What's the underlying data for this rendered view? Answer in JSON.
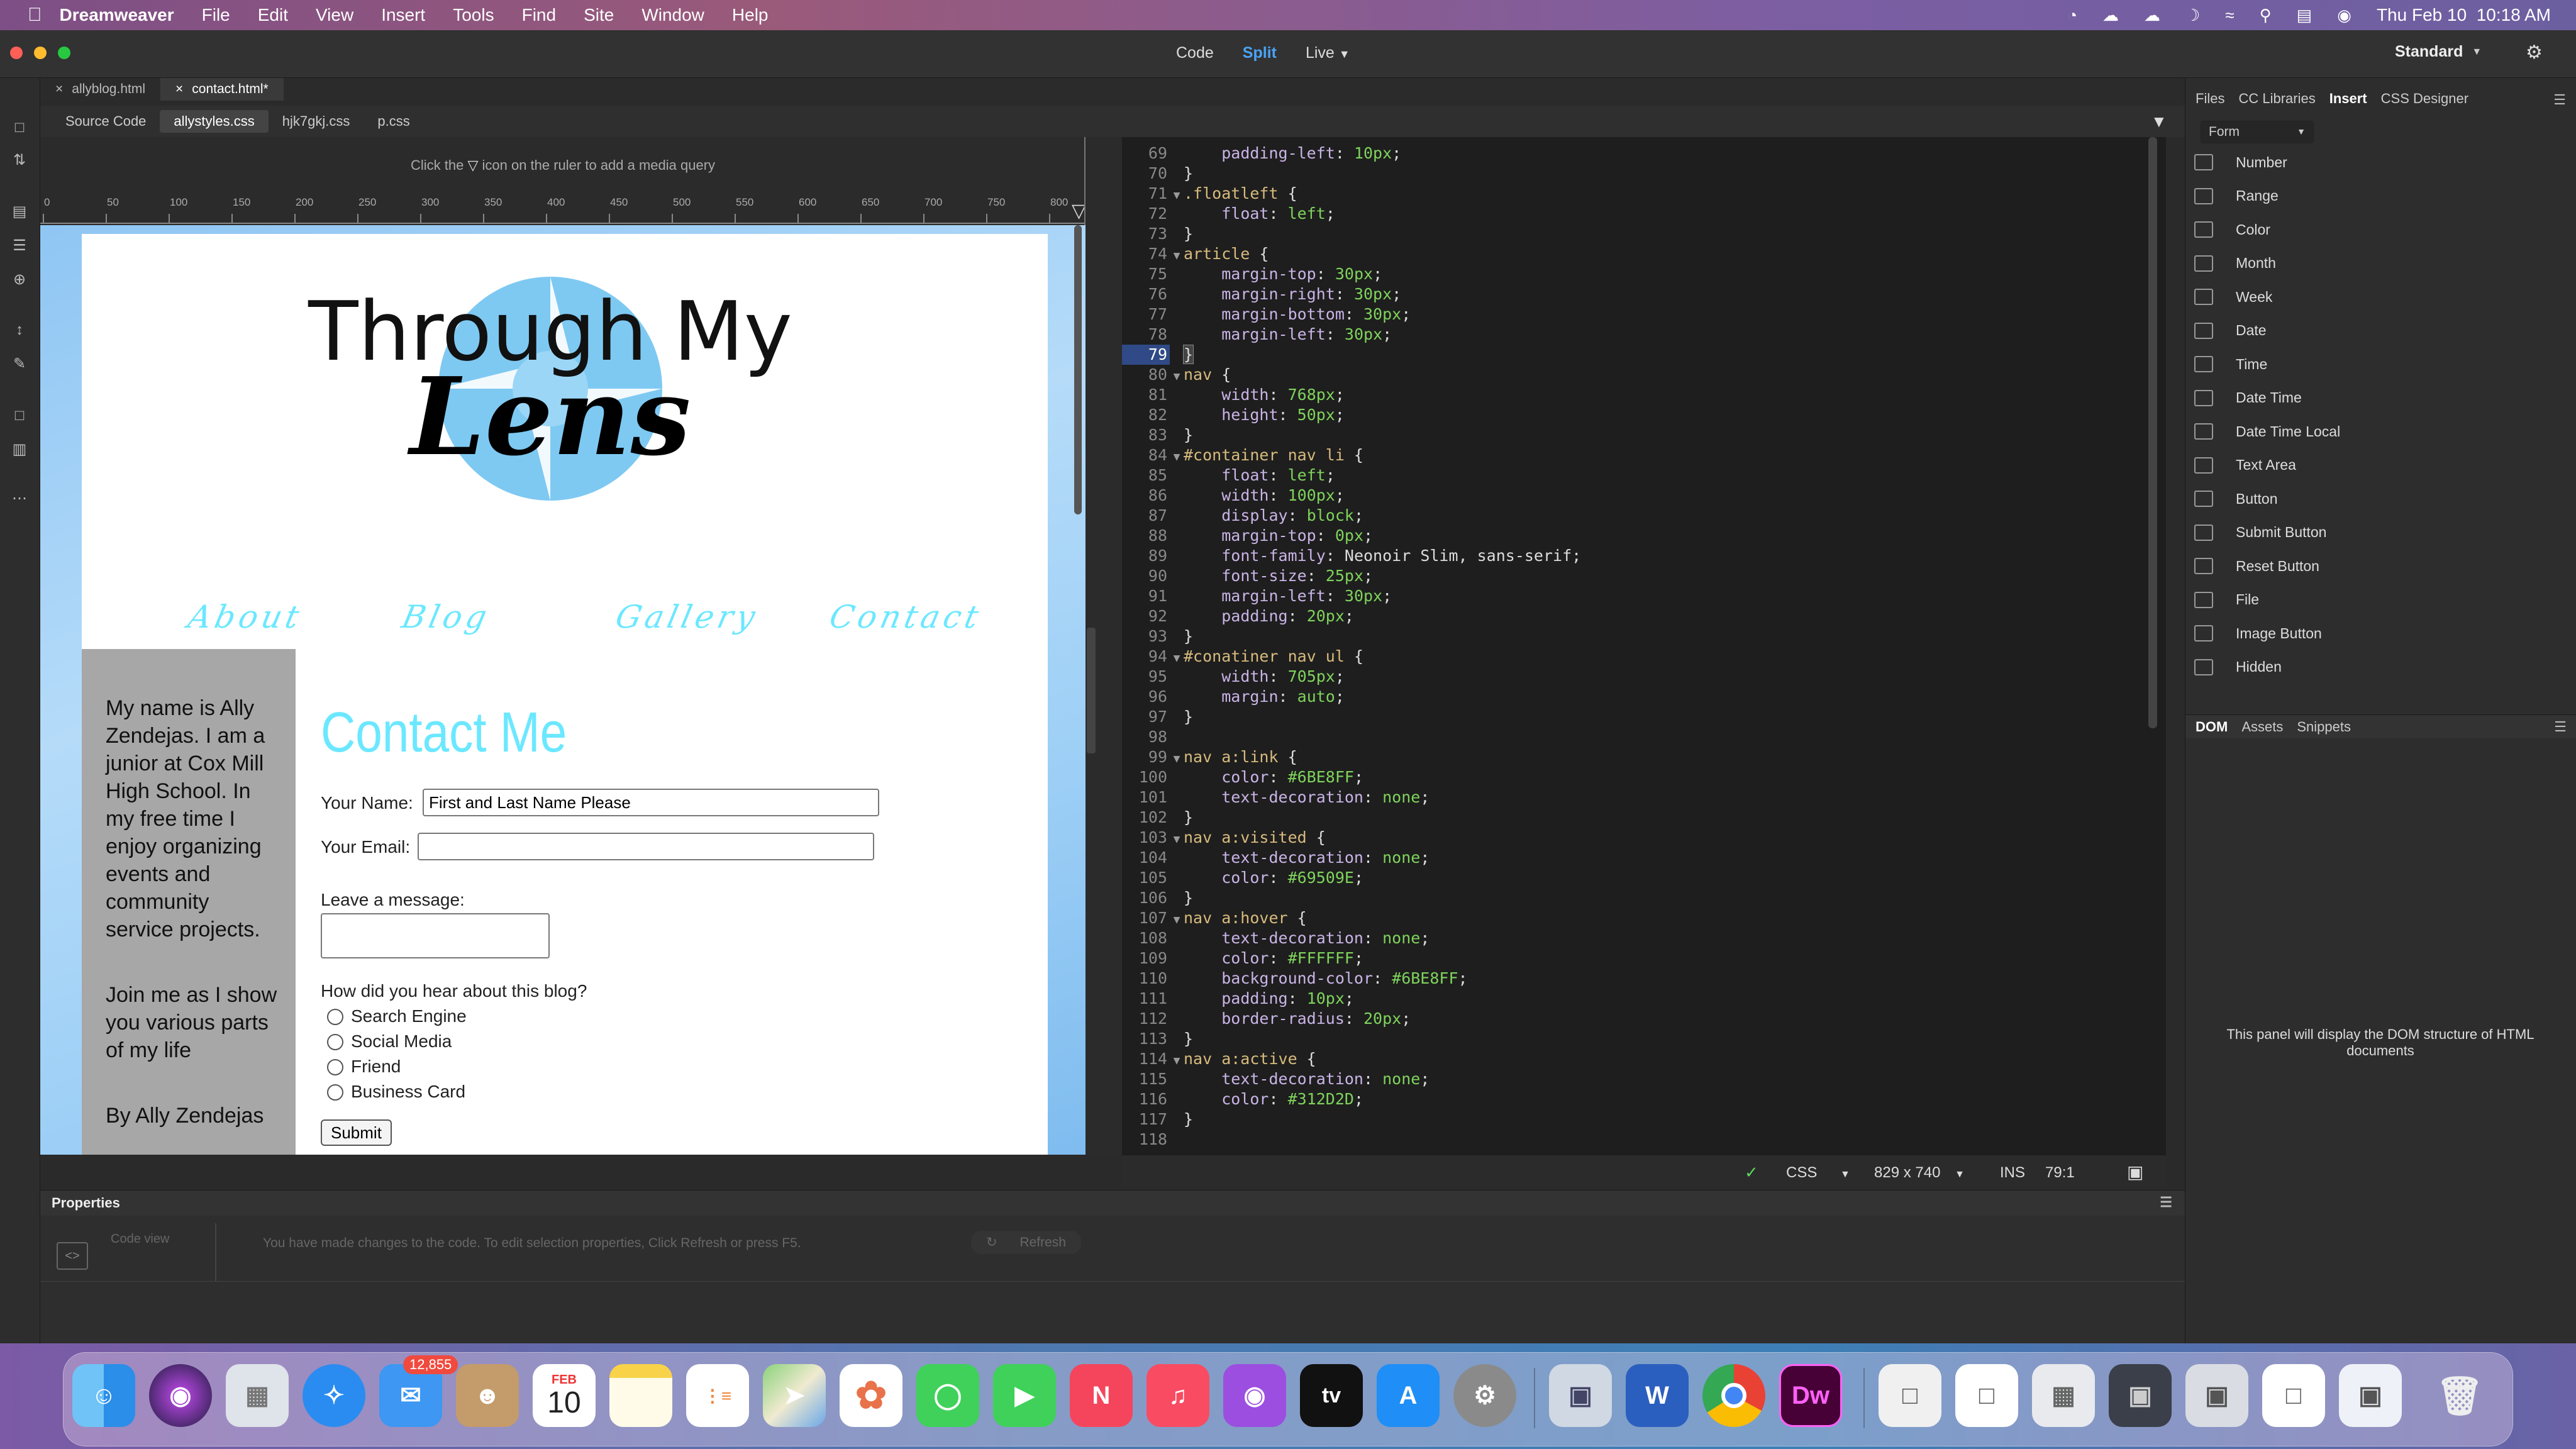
{
  "menubar": {
    "app_name": "Dreamweaver",
    "items": [
      "File",
      "Edit",
      "View",
      "Insert",
      "Tools",
      "Find",
      "Site",
      "Window",
      "Help"
    ],
    "clock": "Thu Feb 10  10:18 AM"
  },
  "titlebar": {
    "views": [
      "Code",
      "Split",
      "Live"
    ],
    "active_view": "Split",
    "workspace": "Standard"
  },
  "doc_tabs": [
    {
      "label": "allyblog.html",
      "active": false
    },
    {
      "label": "contact.html*",
      "active": true
    }
  ],
  "related_files": [
    {
      "label": "Source Code",
      "active": false
    },
    {
      "label": "allystyles.css",
      "active": true
    },
    {
      "label": "hjk7gkj.css",
      "active": false
    },
    {
      "label": "p.css",
      "active": false
    }
  ],
  "media_query_hint": {
    "before": "Click the",
    "after": "icon on the ruler to add a media query"
  },
  "ruler_ticks": [
    "0",
    "50",
    "100",
    "150",
    "200",
    "250",
    "300",
    "350",
    "400",
    "450",
    "500",
    "550",
    "600",
    "650",
    "700",
    "750",
    "800"
  ],
  "live_page": {
    "logo_line1": "Through My",
    "logo_line2": "Lens",
    "nav": [
      "About",
      "Blog",
      "Gallery",
      "Contact"
    ],
    "sidebar": {
      "para1": "My name is Ally Zendejas. I am a junior at Cox Mill High School. In my free time I enjoy organizing events and community service projects.",
      "para2": "Join me as I show you various parts of my life",
      "byline": "By Ally Zendejas"
    },
    "form": {
      "title": "Contact Me",
      "name_label": "Your Name:",
      "name_value": "First and Last Name Please",
      "email_label": "Your Email:",
      "message_label": "Leave a message:",
      "question": "How did you hear about this blog?",
      "options": [
        "Search Engine",
        "Social Media",
        "Friend",
        "Business Card"
      ],
      "submit": "Submit"
    }
  },
  "code_lines": [
    {
      "n": "69",
      "fold": "",
      "text": "    padding-left: 10px;",
      "kind": "decl",
      "prop": "padding-left",
      "value": "10px"
    },
    {
      "n": "70",
      "fold": "",
      "text": "}",
      "kind": "brace"
    },
    {
      "n": "71",
      "fold": "▼",
      "text": ".floatleft {",
      "kind": "sel",
      "sel": ".floatleft"
    },
    {
      "n": "72",
      "fold": "",
      "text": "    float: left;",
      "kind": "decl",
      "prop": "float",
      "value": "left"
    },
    {
      "n": "73",
      "fold": "",
      "text": "}",
      "kind": "brace"
    },
    {
      "n": "74",
      "fold": "▼",
      "text": "article {",
      "kind": "sel",
      "sel": "article"
    },
    {
      "n": "75",
      "fold": "",
      "text": "    margin-top: 30px;",
      "kind": "decl",
      "prop": "margin-top",
      "value": "30px"
    },
    {
      "n": "76",
      "fold": "",
      "text": "    margin-right: 30px;",
      "kind": "decl",
      "prop": "margin-right",
      "value": "30px"
    },
    {
      "n": "77",
      "fold": "",
      "text": "    margin-bottom: 30px;",
      "kind": "decl",
      "prop": "margin-bottom",
      "value": "30px"
    },
    {
      "n": "78",
      "fold": "",
      "text": "    margin-left: 30px;",
      "kind": "decl",
      "prop": "margin-left",
      "value": "30px"
    },
    {
      "n": "79",
      "fold": "",
      "text": "}",
      "kind": "brace",
      "current": true
    },
    {
      "n": "80",
      "fold": "▼",
      "text": "nav {",
      "kind": "sel",
      "sel": "nav"
    },
    {
      "n": "81",
      "fold": "",
      "text": "    width: 768px;",
      "kind": "decl",
      "prop": "width",
      "value": "768px"
    },
    {
      "n": "82",
      "fold": "",
      "text": "    height: 50px;",
      "kind": "decl",
      "prop": "height",
      "value": "50px"
    },
    {
      "n": "83",
      "fold": "",
      "text": "}",
      "kind": "brace"
    },
    {
      "n": "84",
      "fold": "▼",
      "text": "#container nav li {",
      "kind": "sel",
      "sel": "#container nav li"
    },
    {
      "n": "85",
      "fold": "",
      "text": "    float: left;",
      "kind": "decl",
      "prop": "float",
      "value": "left"
    },
    {
      "n": "86",
      "fold": "",
      "text": "    width: 100px;",
      "kind": "decl",
      "prop": "width",
      "value": "100px"
    },
    {
      "n": "87",
      "fold": "",
      "text": "    display: block;",
      "kind": "decl",
      "prop": "display",
      "value": "block"
    },
    {
      "n": "88",
      "fold": "",
      "text": "    margin-top: 0px;",
      "kind": "decl",
      "prop": "margin-top",
      "value": "0px"
    },
    {
      "n": "89",
      "fold": "",
      "text": "    font-family: Neonoir Slim, sans-serif;",
      "kind": "decl",
      "prop": "font-family",
      "value": "Neonoir Slim, sans-serif"
    },
    {
      "n": "90",
      "fold": "",
      "text": "    font-size: 25px;",
      "kind": "decl",
      "prop": "font-size",
      "value": "25px"
    },
    {
      "n": "91",
      "fold": "",
      "text": "    margin-left: 30px;",
      "kind": "decl",
      "prop": "margin-left",
      "value": "30px"
    },
    {
      "n": "92",
      "fold": "",
      "text": "    padding: 20px;",
      "kind": "decl",
      "prop": "padding",
      "value": "20px"
    },
    {
      "n": "93",
      "fold": "",
      "text": "}",
      "kind": "brace"
    },
    {
      "n": "94",
      "fold": "▼",
      "text": "#conatiner nav ul {",
      "kind": "sel",
      "sel": "#conatiner nav ul"
    },
    {
      "n": "95",
      "fold": "",
      "text": "    width: 705px;",
      "kind": "decl",
      "prop": "width",
      "value": "705px"
    },
    {
      "n": "96",
      "fold": "",
      "text": "    margin: auto;",
      "kind": "decl",
      "prop": "margin",
      "value": "auto"
    },
    {
      "n": "97",
      "fold": "",
      "text": "}",
      "kind": "brace"
    },
    {
      "n": "98",
      "fold": "",
      "text": "",
      "kind": "blank"
    },
    {
      "n": "99",
      "fold": "▼",
      "text": "nav a:link {",
      "kind": "sel",
      "sel": "nav a:link"
    },
    {
      "n": "100",
      "fold": "",
      "text": "    color: #6BE8FF;",
      "kind": "decl",
      "prop": "color",
      "value": "#6BE8FF"
    },
    {
      "n": "101",
      "fold": "",
      "text": "    text-decoration: none;",
      "kind": "decl",
      "prop": "text-decoration",
      "value": "none"
    },
    {
      "n": "102",
      "fold": "",
      "text": "}",
      "kind": "brace"
    },
    {
      "n": "103",
      "fold": "▼",
      "text": "nav a:visited {",
      "kind": "sel",
      "sel": "nav a:visited"
    },
    {
      "n": "104",
      "fold": "",
      "text": "    text-decoration: none;",
      "kind": "decl",
      "prop": "text-decoration",
      "value": "none"
    },
    {
      "n": "105",
      "fold": "",
      "text": "    color: #69509E;",
      "kind": "decl",
      "prop": "color",
      "value": "#69509E"
    },
    {
      "n": "106",
      "fold": "",
      "text": "}",
      "kind": "brace"
    },
    {
      "n": "107",
      "fold": "▼",
      "text": "nav a:hover {",
      "kind": "sel",
      "sel": "nav a:hover"
    },
    {
      "n": "108",
      "fold": "",
      "text": "    text-decoration: none;",
      "kind": "decl",
      "prop": "text-decoration",
      "value": "none"
    },
    {
      "n": "109",
      "fold": "",
      "text": "    color: #FFFFFF;",
      "kind": "decl",
      "prop": "color",
      "value": "#FFFFFF"
    },
    {
      "n": "110",
      "fold": "",
      "text": "    background-color: #6BE8FF;",
      "kind": "decl",
      "prop": "background-color",
      "value": "#6BE8FF"
    },
    {
      "n": "111",
      "fold": "",
      "text": "    padding: 10px;",
      "kind": "decl",
      "prop": "padding",
      "value": "10px"
    },
    {
      "n": "112",
      "fold": "",
      "text": "    border-radius: 20px;",
      "kind": "decl",
      "prop": "border-radius",
      "value": "20px"
    },
    {
      "n": "113",
      "fold": "",
      "text": "}",
      "kind": "brace"
    },
    {
      "n": "114",
      "fold": "▼",
      "text": "nav a:active {",
      "kind": "sel",
      "sel": "nav a:active"
    },
    {
      "n": "115",
      "fold": "",
      "text": "    text-decoration: none;",
      "kind": "decl",
      "prop": "text-decoration",
      "value": "none"
    },
    {
      "n": "116",
      "fold": "",
      "text": "    color: #312D2D;",
      "kind": "decl",
      "prop": "color",
      "value": "#312D2D"
    },
    {
      "n": "117",
      "fold": "",
      "text": "}",
      "kind": "brace"
    },
    {
      "n": "118",
      "fold": "",
      "text": "",
      "kind": "blank"
    }
  ],
  "code_status": {
    "language": "CSS",
    "size": "829 x 740",
    "mode": "INS",
    "position": "79:1"
  },
  "properties": {
    "title": "Properties",
    "code_view": "Code view",
    "message": "You have made changes to the code. To edit selection properties, Click Refresh or press F5.",
    "refresh": "Refresh"
  },
  "right_panel": {
    "tabs": [
      "Files",
      "CC Libraries",
      "Insert",
      "CSS Designer"
    ],
    "active_tab": "Insert",
    "category": "Form",
    "insert_items": [
      "Number",
      "Range",
      "Color",
      "Month",
      "Week",
      "Date",
      "Time",
      "Date Time",
      "Date Time Local",
      "Text Area",
      "Button",
      "Submit Button",
      "Reset Button",
      "File",
      "Image Button",
      "Hidden"
    ],
    "lower_tabs": [
      "DOM",
      "Assets",
      "Snippets"
    ],
    "dom_message": "This panel will display the DOM structure of HTML documents"
  },
  "dock": {
    "mail_badge": "12,855",
    "calendar_month": "FEB",
    "calendar_day": "10",
    "apps": [
      "finder",
      "siri",
      "launchpad",
      "safari",
      "mail",
      "contacts",
      "calendar",
      "notes",
      "reminders",
      "maps",
      "photos",
      "messages",
      "facetime",
      "news",
      "music",
      "podcasts",
      "tv",
      "app-store",
      "system-preferences",
      "preview",
      "word",
      "chrome",
      "dreamweaver"
    ]
  },
  "colors": {
    "accent": "#6BE8FF",
    "split_active": "#4aa3f5",
    "code_bg": "#1e1e1e",
    "sidebar_gray": "#a7a7a7"
  }
}
